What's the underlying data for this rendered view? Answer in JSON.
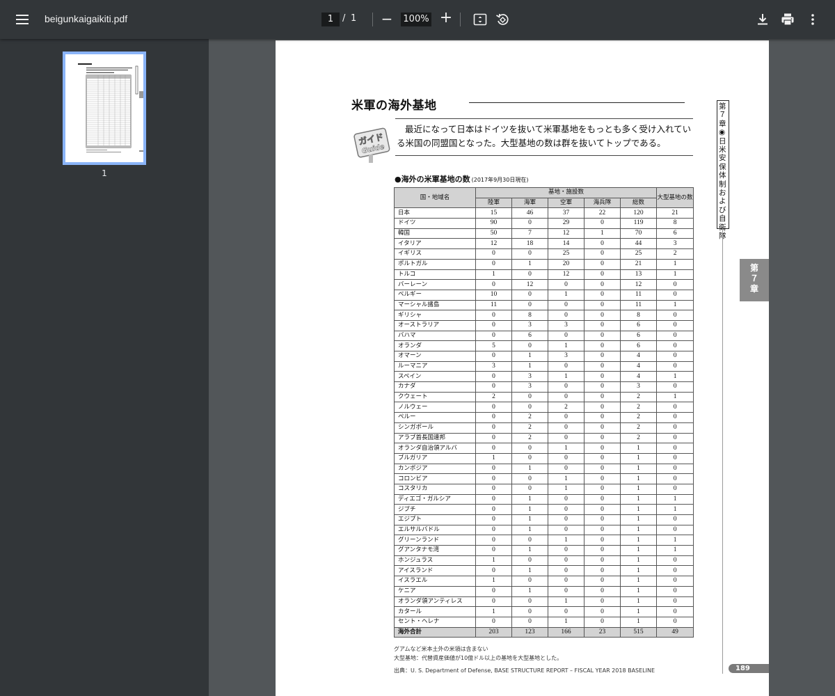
{
  "toolbar": {
    "filename": "beigunkaigaikiti.pdf",
    "current_page": "1",
    "separator": "/",
    "total_pages": "1",
    "zoom": "100%",
    "zoom_minus": "−",
    "zoom_plus": "+",
    "icons": [
      "menu-icon",
      "fit-page-icon",
      "rotate-icon",
      "download-icon",
      "print-icon",
      "more-vert-icon"
    ]
  },
  "sidebar": {
    "thumbnail_label": "1"
  },
  "document": {
    "title": "米軍の海外基地",
    "guide_text": "最近になって日本はドイツを抜いて米軍基地をもっとも多く受け入れている米国の同盟国となった。大型基地の数は群を抜いてトップである。",
    "guide_logo_text_1": "ガイド",
    "guide_logo_text_2": "Guide",
    "table_heading": "●海外の米軍基地の数",
    "table_heading_note": "(2017年9月30日現在)",
    "header": {
      "country": "国・地域名",
      "group": "基地・施設数",
      "army": "陸軍",
      "navy": "海軍",
      "airforce": "空軍",
      "marines": "海兵隊",
      "total": "総数",
      "large": "大型基地の数"
    },
    "rows": [
      [
        "日本",
        "15",
        "46",
        "37",
        "22",
        "120",
        "21"
      ],
      [
        "ドイツ",
        "90",
        "0",
        "29",
        "0",
        "119",
        "8"
      ],
      [
        "韓国",
        "50",
        "7",
        "12",
        "1",
        "70",
        "6"
      ],
      [
        "イタリア",
        "12",
        "18",
        "14",
        "0",
        "44",
        "3"
      ],
      [
        "イギリス",
        "0",
        "0",
        "25",
        "0",
        "25",
        "2"
      ],
      [
        "ポルトガル",
        "0",
        "1",
        "20",
        "0",
        "21",
        "1"
      ],
      [
        "トルコ",
        "1",
        "0",
        "12",
        "0",
        "13",
        "1"
      ],
      [
        "バーレーン",
        "0",
        "12",
        "0",
        "0",
        "12",
        "0"
      ],
      [
        "ベルギー",
        "10",
        "0",
        "1",
        "0",
        "11",
        "0"
      ],
      [
        "マーシャル諸島",
        "11",
        "0",
        "0",
        "0",
        "11",
        "1"
      ],
      [
        "ギリシャ",
        "0",
        "8",
        "0",
        "0",
        "8",
        "0"
      ],
      [
        "オーストラリア",
        "0",
        "3",
        "3",
        "0",
        "6",
        "0"
      ],
      [
        "バハマ",
        "0",
        "6",
        "0",
        "0",
        "6",
        "0"
      ],
      [
        "オランダ",
        "5",
        "0",
        "1",
        "0",
        "6",
        "0"
      ],
      [
        "オマーン",
        "0",
        "1",
        "3",
        "0",
        "4",
        "0"
      ],
      [
        "ルーマニア",
        "3",
        "1",
        "0",
        "0",
        "4",
        "0"
      ],
      [
        "スペイン",
        "0",
        "3",
        "1",
        "0",
        "4",
        "1"
      ],
      [
        "カナダ",
        "0",
        "3",
        "0",
        "0",
        "3",
        "0"
      ],
      [
        "クウェート",
        "2",
        "0",
        "0",
        "0",
        "2",
        "1"
      ],
      [
        "ノルウェー",
        "0",
        "0",
        "2",
        "0",
        "2",
        "0"
      ],
      [
        "ペルー",
        "0",
        "2",
        "0",
        "0",
        "2",
        "0"
      ],
      [
        "シンガポール",
        "0",
        "2",
        "0",
        "0",
        "2",
        "0"
      ],
      [
        "アラブ首長国連邦",
        "0",
        "2",
        "0",
        "0",
        "2",
        "0"
      ],
      [
        "オランダ自治領アルバ",
        "0",
        "0",
        "1",
        "0",
        "1",
        "0"
      ],
      [
        "ブルガリア",
        "1",
        "0",
        "0",
        "0",
        "1",
        "0"
      ],
      [
        "カンボジア",
        "0",
        "1",
        "0",
        "0",
        "1",
        "0"
      ],
      [
        "コロンビア",
        "0",
        "0",
        "1",
        "0",
        "1",
        "0"
      ],
      [
        "コスタリカ",
        "0",
        "0",
        "1",
        "0",
        "1",
        "0"
      ],
      [
        "ディエゴ・ガルシア",
        "0",
        "1",
        "0",
        "0",
        "1",
        "1"
      ],
      [
        "ジブチ",
        "0",
        "1",
        "0",
        "0",
        "1",
        "1"
      ],
      [
        "エジプト",
        "0",
        "1",
        "0",
        "0",
        "1",
        "0"
      ],
      [
        "エルサルバドル",
        "0",
        "1",
        "0",
        "0",
        "1",
        "0"
      ],
      [
        "グリーンランド",
        "0",
        "0",
        "1",
        "0",
        "1",
        "1"
      ],
      [
        "グアンタナモ湾",
        "0",
        "1",
        "0",
        "0",
        "1",
        "1"
      ],
      [
        "ホンジュラス",
        "1",
        "0",
        "0",
        "0",
        "1",
        "0"
      ],
      [
        "アイスランド",
        "0",
        "1",
        "0",
        "0",
        "1",
        "0"
      ],
      [
        "イスラエル",
        "1",
        "0",
        "0",
        "0",
        "1",
        "0"
      ],
      [
        "ケニア",
        "0",
        "1",
        "0",
        "0",
        "1",
        "0"
      ],
      [
        "オランダ領アンティレス",
        "0",
        "0",
        "1",
        "0",
        "1",
        "0"
      ],
      [
        "カタール",
        "1",
        "0",
        "0",
        "0",
        "1",
        "0"
      ],
      [
        "セント・ヘレナ",
        "0",
        "0",
        "1",
        "0",
        "1",
        "0"
      ]
    ],
    "total_row": [
      "海外合計",
      "203",
      "123",
      "166",
      "23",
      "515",
      "49"
    ],
    "footnote_1": "グアムなど米本土外の米領は含まない",
    "footnote_2": "大型基地：代替資産価値が10億ドル以上の基地を大型基地とした。",
    "source": "出典：U. S. Department of Defense, BASE STRUCTURE REPORT – FISCAL YEAR 2018 BASELINE",
    "side_label": "第７章◉日米安保体制および自衛隊",
    "chapter_tab": "第７章",
    "page_number": "189"
  }
}
